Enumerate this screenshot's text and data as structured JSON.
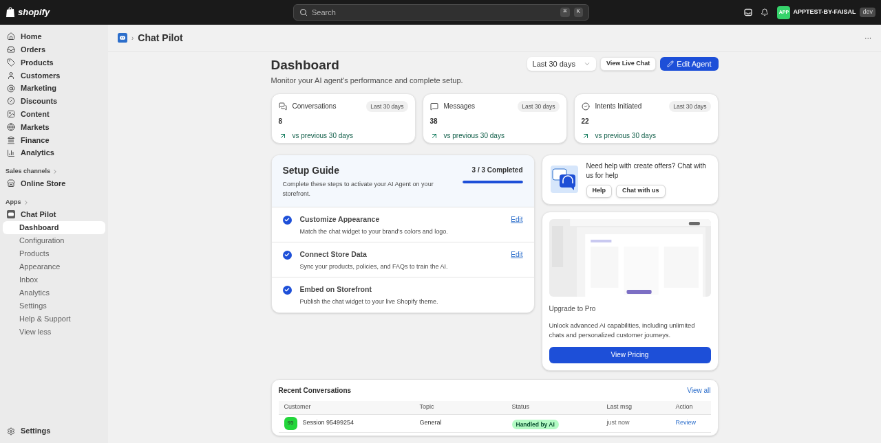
{
  "topbar": {
    "logo": "shopify",
    "search": {
      "placeholder": "Search"
    },
    "shortcut": [
      "⌘",
      "K"
    ],
    "store": {
      "avatar": "APP",
      "name": "APPTEST-BY-FAISAL",
      "badge": "dev"
    }
  },
  "sidebar": {
    "items": [
      {
        "label": "Home",
        "selected": false
      },
      {
        "label": "Orders",
        "selected": false
      },
      {
        "label": "Products",
        "selected": false
      },
      {
        "label": "Customers",
        "selected": false
      },
      {
        "label": "Marketing",
        "selected": false
      },
      {
        "label": "Discounts",
        "selected": false
      },
      {
        "label": "Content",
        "selected": false
      },
      {
        "label": "Markets",
        "selected": false
      },
      {
        "label": "Finance",
        "selected": false
      },
      {
        "label": "Analytics",
        "selected": false
      }
    ],
    "sales_channels": {
      "heading": "Sales channels",
      "items": [
        {
          "label": "Online Store",
          "selected": false
        }
      ]
    },
    "apps": {
      "heading": "Apps",
      "app": {
        "label": "Chat Pilot",
        "children": [
          {
            "label": "Dashboard",
            "selected": true
          },
          {
            "label": "Configuration",
            "selected": false
          },
          {
            "label": "Products",
            "selected": false
          },
          {
            "label": "Appearance",
            "selected": false
          },
          {
            "label": "Inbox",
            "selected": false
          },
          {
            "label": "Analytics",
            "selected": false
          },
          {
            "label": "Settings",
            "selected": false
          },
          {
            "label": "Help & Support",
            "selected": false
          },
          {
            "label": "View less",
            "selected": false
          }
        ]
      }
    },
    "settings": "Settings"
  },
  "breadcrumb": {
    "separator": "›",
    "title": "Chat Pilot",
    "more": "···"
  },
  "page": {
    "title": "Dashboard",
    "subtitle": "Monitor your AI agent's performance and complete setup.",
    "range": "Last 30 days",
    "buttons": [
      "View Live Chat",
      "Edit Agent"
    ]
  },
  "stats": [
    {
      "label": "Conversations",
      "period": "Last 30 days",
      "value": "8",
      "trend": "vs previous 30 days"
    },
    {
      "label": "Messages",
      "period": "Last 30 days",
      "value": "38",
      "trend": "vs previous 30 days"
    },
    {
      "label": "Intents Initiated",
      "period": "Last 30 days",
      "value": "22",
      "trend": "vs previous 30 days"
    }
  ],
  "setup_guide": {
    "title": "Setup Guide",
    "description": "Complete these steps to activate your AI Agent on your storefront.",
    "progress_text": "3 / 3 Completed",
    "level": 1,
    "steps": [
      {
        "title": "Customize Appearance",
        "description": "Match the chat widget to your brand's colors and logo.",
        "checked": true,
        "action": "Edit"
      },
      {
        "title": "Connect Store Data",
        "description": "Sync your products, policies, and FAQs to train the AI.",
        "checked": true,
        "action": "Edit"
      },
      {
        "title": "Embed on Storefront",
        "description": "Publish the chat widget to your live Shopify theme.",
        "checked": true
      }
    ]
  },
  "help_card": {
    "text": "Need help with create offers? Chat with us for help",
    "buttons": [
      "Help",
      "Chat with us"
    ]
  },
  "upgrade_card": {
    "title": "Upgrade to Pro",
    "description": "Unlock advanced AI capabilities, including unlimited chats and personalized customer journeys.",
    "button": "View Pricing"
  },
  "recent_conversations": {
    "title": "Recent Conversations",
    "link": "View all",
    "columns": [
      "Customer",
      "Topic",
      "Status",
      "Last msg",
      "Action"
    ],
    "rows": [
      {
        "avatar": "95",
        "customer": "Session 95499254",
        "topic": "General",
        "status": "Handled by AI",
        "last_msg": "just now",
        "action": "Review"
      }
    ]
  }
}
